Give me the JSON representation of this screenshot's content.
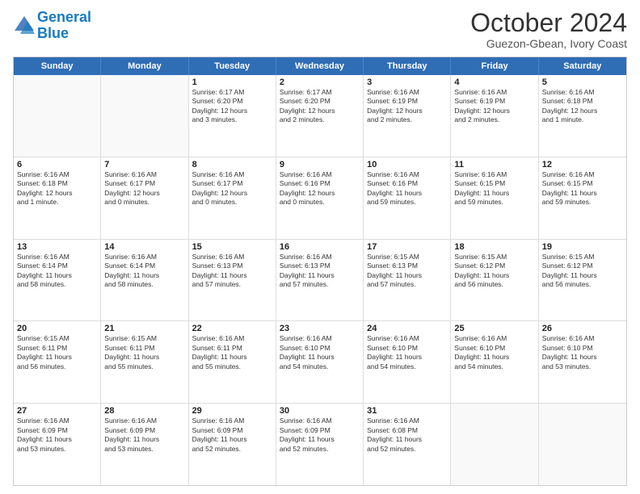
{
  "header": {
    "logo_line1": "General",
    "logo_line2": "Blue",
    "month_title": "October 2024",
    "location": "Guezon-Gbean, Ivory Coast"
  },
  "weekdays": [
    "Sunday",
    "Monday",
    "Tuesday",
    "Wednesday",
    "Thursday",
    "Friday",
    "Saturday"
  ],
  "rows": [
    [
      {
        "day": "",
        "empty": true
      },
      {
        "day": "",
        "empty": true
      },
      {
        "day": "1",
        "lines": [
          "Sunrise: 6:17 AM",
          "Sunset: 6:20 PM",
          "Daylight: 12 hours",
          "and 3 minutes."
        ]
      },
      {
        "day": "2",
        "lines": [
          "Sunrise: 6:17 AM",
          "Sunset: 6:20 PM",
          "Daylight: 12 hours",
          "and 2 minutes."
        ]
      },
      {
        "day": "3",
        "lines": [
          "Sunrise: 6:16 AM",
          "Sunset: 6:19 PM",
          "Daylight: 12 hours",
          "and 2 minutes."
        ]
      },
      {
        "day": "4",
        "lines": [
          "Sunrise: 6:16 AM",
          "Sunset: 6:19 PM",
          "Daylight: 12 hours",
          "and 2 minutes."
        ]
      },
      {
        "day": "5",
        "lines": [
          "Sunrise: 6:16 AM",
          "Sunset: 6:18 PM",
          "Daylight: 12 hours",
          "and 1 minute."
        ]
      }
    ],
    [
      {
        "day": "6",
        "lines": [
          "Sunrise: 6:16 AM",
          "Sunset: 6:18 PM",
          "Daylight: 12 hours",
          "and 1 minute."
        ]
      },
      {
        "day": "7",
        "lines": [
          "Sunrise: 6:16 AM",
          "Sunset: 6:17 PM",
          "Daylight: 12 hours",
          "and 0 minutes."
        ]
      },
      {
        "day": "8",
        "lines": [
          "Sunrise: 6:16 AM",
          "Sunset: 6:17 PM",
          "Daylight: 12 hours",
          "and 0 minutes."
        ]
      },
      {
        "day": "9",
        "lines": [
          "Sunrise: 6:16 AM",
          "Sunset: 6:16 PM",
          "Daylight: 12 hours",
          "and 0 minutes."
        ]
      },
      {
        "day": "10",
        "lines": [
          "Sunrise: 6:16 AM",
          "Sunset: 6:16 PM",
          "Daylight: 11 hours",
          "and 59 minutes."
        ]
      },
      {
        "day": "11",
        "lines": [
          "Sunrise: 6:16 AM",
          "Sunset: 6:15 PM",
          "Daylight: 11 hours",
          "and 59 minutes."
        ]
      },
      {
        "day": "12",
        "lines": [
          "Sunrise: 6:16 AM",
          "Sunset: 6:15 PM",
          "Daylight: 11 hours",
          "and 59 minutes."
        ]
      }
    ],
    [
      {
        "day": "13",
        "lines": [
          "Sunrise: 6:16 AM",
          "Sunset: 6:14 PM",
          "Daylight: 11 hours",
          "and 58 minutes."
        ]
      },
      {
        "day": "14",
        "lines": [
          "Sunrise: 6:16 AM",
          "Sunset: 6:14 PM",
          "Daylight: 11 hours",
          "and 58 minutes."
        ]
      },
      {
        "day": "15",
        "lines": [
          "Sunrise: 6:16 AM",
          "Sunset: 6:13 PM",
          "Daylight: 11 hours",
          "and 57 minutes."
        ]
      },
      {
        "day": "16",
        "lines": [
          "Sunrise: 6:16 AM",
          "Sunset: 6:13 PM",
          "Daylight: 11 hours",
          "and 57 minutes."
        ]
      },
      {
        "day": "17",
        "lines": [
          "Sunrise: 6:15 AM",
          "Sunset: 6:13 PM",
          "Daylight: 11 hours",
          "and 57 minutes."
        ]
      },
      {
        "day": "18",
        "lines": [
          "Sunrise: 6:15 AM",
          "Sunset: 6:12 PM",
          "Daylight: 11 hours",
          "and 56 minutes."
        ]
      },
      {
        "day": "19",
        "lines": [
          "Sunrise: 6:15 AM",
          "Sunset: 6:12 PM",
          "Daylight: 11 hours",
          "and 56 minutes."
        ]
      }
    ],
    [
      {
        "day": "20",
        "lines": [
          "Sunrise: 6:15 AM",
          "Sunset: 6:11 PM",
          "Daylight: 11 hours",
          "and 56 minutes."
        ]
      },
      {
        "day": "21",
        "lines": [
          "Sunrise: 6:15 AM",
          "Sunset: 6:11 PM",
          "Daylight: 11 hours",
          "and 55 minutes."
        ]
      },
      {
        "day": "22",
        "lines": [
          "Sunrise: 6:16 AM",
          "Sunset: 6:11 PM",
          "Daylight: 11 hours",
          "and 55 minutes."
        ]
      },
      {
        "day": "23",
        "lines": [
          "Sunrise: 6:16 AM",
          "Sunset: 6:10 PM",
          "Daylight: 11 hours",
          "and 54 minutes."
        ]
      },
      {
        "day": "24",
        "lines": [
          "Sunrise: 6:16 AM",
          "Sunset: 6:10 PM",
          "Daylight: 11 hours",
          "and 54 minutes."
        ]
      },
      {
        "day": "25",
        "lines": [
          "Sunrise: 6:16 AM",
          "Sunset: 6:10 PM",
          "Daylight: 11 hours",
          "and 54 minutes."
        ]
      },
      {
        "day": "26",
        "lines": [
          "Sunrise: 6:16 AM",
          "Sunset: 6:10 PM",
          "Daylight: 11 hours",
          "and 53 minutes."
        ]
      }
    ],
    [
      {
        "day": "27",
        "lines": [
          "Sunrise: 6:16 AM",
          "Sunset: 6:09 PM",
          "Daylight: 11 hours",
          "and 53 minutes."
        ]
      },
      {
        "day": "28",
        "lines": [
          "Sunrise: 6:16 AM",
          "Sunset: 6:09 PM",
          "Daylight: 11 hours",
          "and 53 minutes."
        ]
      },
      {
        "day": "29",
        "lines": [
          "Sunrise: 6:16 AM",
          "Sunset: 6:09 PM",
          "Daylight: 11 hours",
          "and 52 minutes."
        ]
      },
      {
        "day": "30",
        "lines": [
          "Sunrise: 6:16 AM",
          "Sunset: 6:09 PM",
          "Daylight: 11 hours",
          "and 52 minutes."
        ]
      },
      {
        "day": "31",
        "lines": [
          "Sunrise: 6:16 AM",
          "Sunset: 6:08 PM",
          "Daylight: 11 hours",
          "and 52 minutes."
        ]
      },
      {
        "day": "",
        "empty": true
      },
      {
        "day": "",
        "empty": true
      }
    ]
  ]
}
